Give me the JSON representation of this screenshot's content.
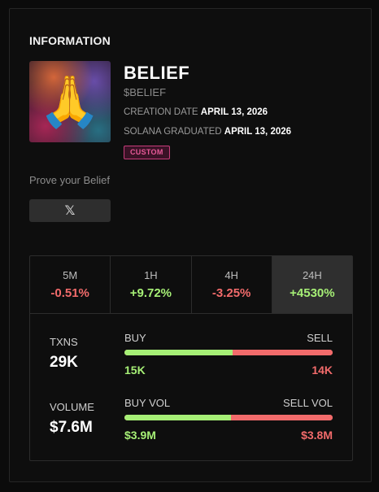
{
  "section_title": "INFORMATION",
  "token": {
    "image_icon": "folded-hands-emoji",
    "image_glyph": "🙏",
    "name": "BELIEF",
    "ticker": "$BELIEF",
    "creation_label": "CREATION DATE",
    "creation_value": "APRIL 13, 2026",
    "graduated_label": "SOLANA GRADUATED",
    "graduated_value": "APRIL 13, 2026",
    "badge": "CUSTOM"
  },
  "tagline": "Prove your Belief",
  "social": {
    "x_icon": "x-logo-icon",
    "x_glyph": "𝕏"
  },
  "colors": {
    "positive": "#a6ef76",
    "negative": "#f26b6b",
    "badge": "#e75a98"
  },
  "timeframes": [
    {
      "label": "5M",
      "change": "-0.51%",
      "trend": "negative"
    },
    {
      "label": "1H",
      "change": "+9.72%",
      "trend": "positive"
    },
    {
      "label": "4H",
      "change": "-3.25%",
      "trend": "negative"
    },
    {
      "label": "24H",
      "change": "+4530%",
      "trend": "positive",
      "selected": true
    }
  ],
  "txns": {
    "label": "TXNS",
    "value": "29K",
    "buy_label": "BUY",
    "sell_label": "SELL",
    "buy_value": "15K",
    "sell_value": "14K",
    "buy_fraction": 0.52
  },
  "volume": {
    "label": "VOLUME",
    "value": "$7.6M",
    "buy_label": "BUY VOL",
    "sell_label": "SELL VOL",
    "buy_value": "$3.9M",
    "sell_value": "$3.8M",
    "buy_fraction": 0.51
  }
}
